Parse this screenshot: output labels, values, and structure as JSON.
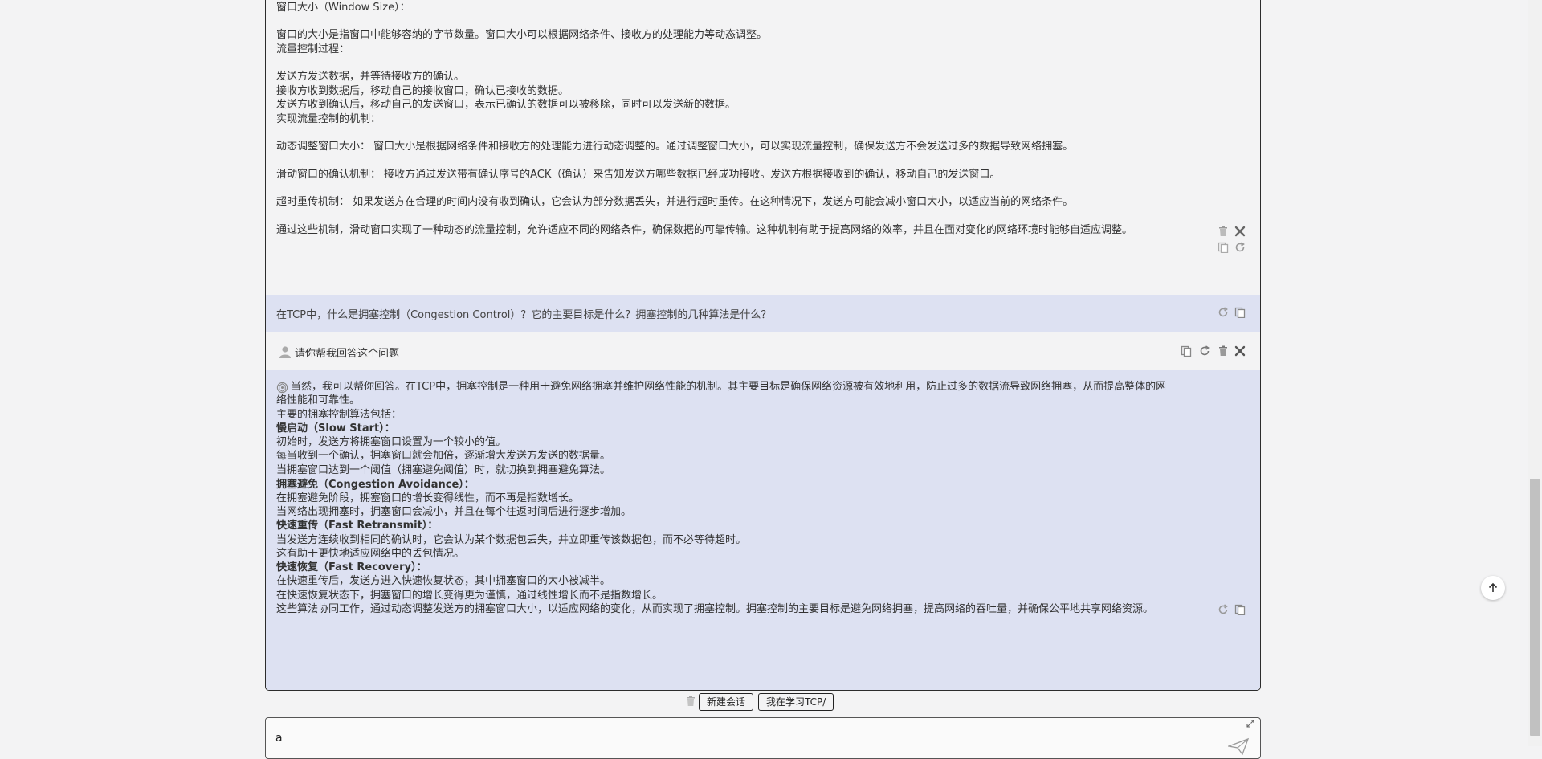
{
  "previous_answer": {
    "lines": [
      {
        "text": "窗口大小（Window Size）：",
        "bold": false
      },
      {
        "text": "",
        "bold": false
      },
      {
        "text": "窗口的大小是指窗口中能够容纳的字节数量。窗口大小可以根据网络条件、接收方的处理能力等动态调整。",
        "bold": false
      },
      {
        "text": "流量控制过程：",
        "bold": false
      },
      {
        "text": "",
        "bold": false
      },
      {
        "text": "发送方发送数据，并等待接收方的确认。",
        "bold": false
      },
      {
        "text": "接收方收到数据后，移动自己的接收窗口，确认已接收的数据。",
        "bold": false
      },
      {
        "text": "发送方收到确认后，移动自己的发送窗口，表示已确认的数据可以被移除，同时可以发送新的数据。",
        "bold": false
      },
      {
        "text": "实现流量控制的机制：",
        "bold": false
      },
      {
        "text": "",
        "bold": false
      },
      {
        "text": "动态调整窗口大小： 窗口大小是根据网络条件和接收方的处理能力进行动态调整的。通过调整窗口大小，可以实现流量控制，确保发送方不会发送过多的数据导致网络拥塞。",
        "bold": false
      },
      {
        "text": "",
        "bold": false
      },
      {
        "text": "滑动窗口的确认机制： 接收方通过发送带有确认序号的ACK（确认）来告知发送方哪些数据已经成功接收。发送方根据接收到的确认，移动自己的发送窗口。",
        "bold": false
      },
      {
        "text": "",
        "bold": false
      },
      {
        "text": "超时重传机制： 如果发送方在合理的时间内没有收到确认，它会认为部分数据丢失，并进行超时重传。在这种情况下，发送方可能会减小窗口大小，以适应当前的网络条件。",
        "bold": false
      },
      {
        "text": "",
        "bold": false
      },
      {
        "text": "通过这些机制，滑动窗口实现了一种动态的流量控制，允许适应不同的网络条件，确保数据的可靠传输。这种机制有助于提高网络的效率，并且在面对变化的网络环境时能够自适应调整。",
        "bold": false
      }
    ]
  },
  "question": {
    "text": "在TCP中，什么是拥塞控制（Congestion Control）？它的主要目标是什么？拥塞控制的几种算法是什么？"
  },
  "user_message": {
    "text": "请你帮我回答这个问题"
  },
  "answer": {
    "lines": [
      {
        "text": "当然，我可以帮你回答。在TCP中，拥塞控制是一种用于避免网络拥塞并维护网络性能的机制。其主要目标是确保网络资源被有效地利用，防止过多的数据流导致网络拥塞，从而提高整体的网",
        "bold": false
      },
      {
        "text": "络性能和可靠性。",
        "bold": false
      },
      {
        "text": "主要的拥塞控制算法包括：",
        "bold": false
      },
      {
        "text": "慢启动（Slow Start）：",
        "bold": true
      },
      {
        "text": "初始时，发送方将拥塞窗口设置为一个较小的值。",
        "bold": false
      },
      {
        "text": "每当收到一个确认，拥塞窗口就会加倍，逐渐增大发送方发送的数据量。",
        "bold": false
      },
      {
        "text": "当拥塞窗口达到一个阈值（拥塞避免阈值）时，就切换到拥塞避免算法。",
        "bold": false
      },
      {
        "text": "拥塞避免（Congestion Avoidance）：",
        "bold": true
      },
      {
        "text": "在拥塞避免阶段，拥塞窗口的增长变得线性，而不再是指数增长。",
        "bold": false
      },
      {
        "text": "当网络出现拥塞时，拥塞窗口会减小，并且在每个往返时间后进行逐步增加。",
        "bold": false
      },
      {
        "text": "快速重传（Fast Retransmit）：",
        "bold": true
      },
      {
        "text": "当发送方连续收到相同的确认时，它会认为某个数据包丢失，并立即重传该数据包，而不必等待超时。",
        "bold": false
      },
      {
        "text": "这有助于更快地适应网络中的丢包情况。",
        "bold": false
      },
      {
        "text": "快速恢复（Fast Recovery）：",
        "bold": true
      },
      {
        "text": "在快速重传后，发送方进入快速恢复状态，其中拥塞窗口的大小被减半。",
        "bold": false
      },
      {
        "text": "在快速恢复状态下，拥塞窗口的增长变得更为谨慎，通过线性增长而不是指数增长。",
        "bold": false
      },
      {
        "text": "这些算法协同工作，通过动态调整发送方的拥塞窗口大小，以适应网络的变化，从而实现了拥塞控制。拥塞控制的主要目标是避免网络拥塞，提高网络的吞吐量，并确保公平地共享网络资源。",
        "bold": false
      }
    ]
  },
  "toolbar": {
    "new_chat_label": "新建会话",
    "topic_label": "我在学习TCP/"
  },
  "input": {
    "value": "a"
  },
  "colors": {
    "background": "#f3f3f4",
    "highlight_row": "#dde1f2",
    "icon": "#777777"
  }
}
